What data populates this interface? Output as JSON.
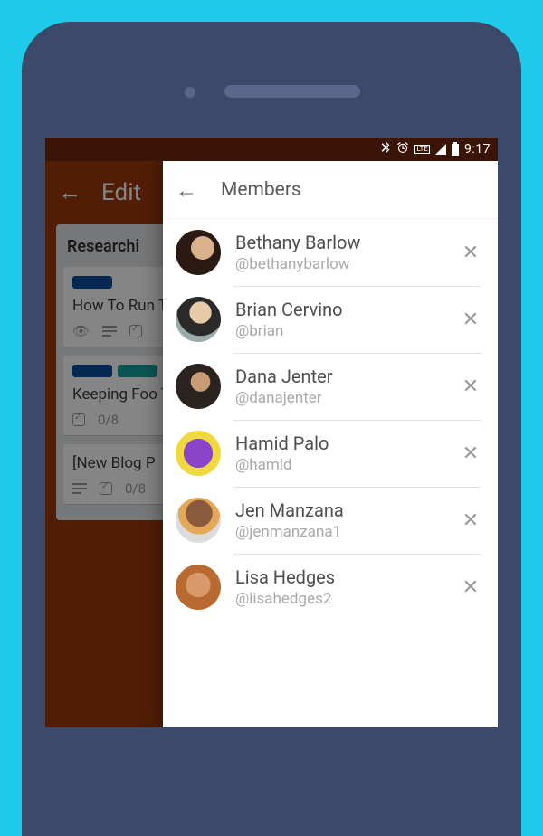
{
  "status_bar": {
    "lte": "LTE",
    "time": "9:17"
  },
  "board": {
    "title": "Edit",
    "list_title": "Researchi",
    "cards": [
      {
        "title": "How To Run Trello",
        "labels": [
          "blue"
        ],
        "badges": "check"
      },
      {
        "title": "Keeping Foo Traveling",
        "labels": [
          "blue",
          "teal"
        ],
        "check_text": "0/8"
      },
      {
        "title": "[New Blog P",
        "check_text": "0/8"
      }
    ]
  },
  "drawer": {
    "title": "Members",
    "members": [
      {
        "name": "Bethany Barlow",
        "handle": "@bethanybarlow"
      },
      {
        "name": "Brian Cervino",
        "handle": "@brian"
      },
      {
        "name": "Dana Jenter",
        "handle": "@danajenter"
      },
      {
        "name": "Hamid Palo",
        "handle": "@hamid"
      },
      {
        "name": "Jen Manzana",
        "handle": "@jenmanzana1"
      },
      {
        "name": "Lisa Hedges",
        "handle": "@lisahedges2"
      }
    ]
  }
}
